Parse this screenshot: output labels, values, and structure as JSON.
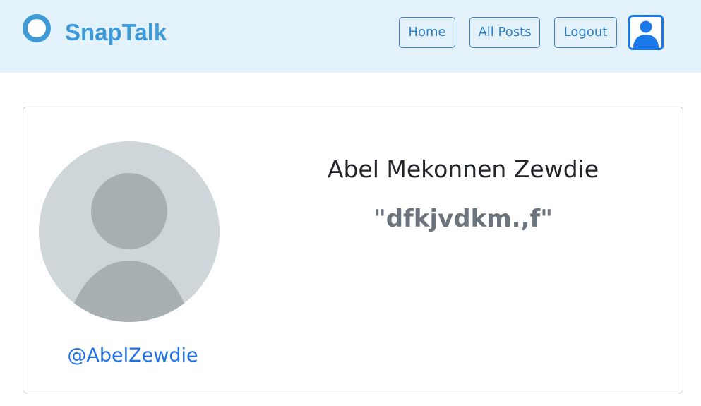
{
  "app": {
    "brand_name": "SnapTalk",
    "logo_icon": "ring-logo-icon",
    "accent_color": "#3d9ad8"
  },
  "nav": {
    "home_label": "Home",
    "all_posts_label": "All Posts",
    "logout_label": "Logout",
    "profile_icon": "user-icon",
    "profile_icon_color": "#1a78e8"
  },
  "profile": {
    "full_name": "Abel Mekonnen Zewdie",
    "bio": "\"dfkjvdkm.,f\"",
    "username": "@AbelZewdie",
    "avatar_icon": "default-avatar-icon",
    "username_color": "#1f72e6"
  }
}
